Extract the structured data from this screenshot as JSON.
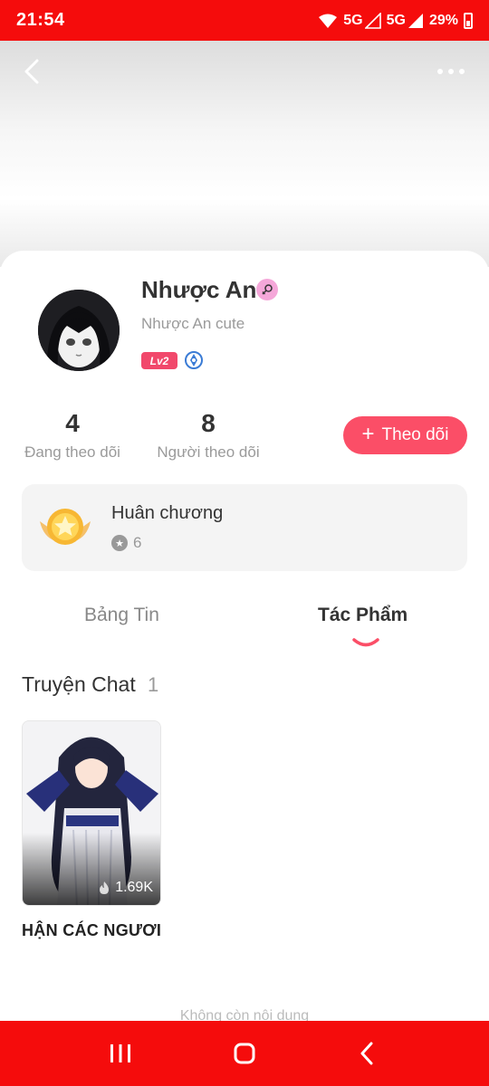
{
  "status_bar": {
    "time": "21:54",
    "network_1": "5G",
    "network_2": "5G",
    "battery": "29%"
  },
  "header": {
    "back_icon": "chevron-left-icon",
    "more_icon": "more-dots-icon"
  },
  "profile": {
    "name": "Nhược An",
    "subtitle": "Nhược An cute",
    "level": "Lv2",
    "gender_icon": "female-icon",
    "rank_icon": "rank-badge-icon"
  },
  "stats": [
    {
      "value": "4",
      "label": "Đang theo dõi"
    },
    {
      "value": "8",
      "label": "Người theo dõi"
    }
  ],
  "follow_button": {
    "label": "Theo dõi",
    "color": "#fb4e67"
  },
  "medals": {
    "title": "Huân chương",
    "count": "6"
  },
  "tabs": [
    {
      "label": "Bảng Tin",
      "active": false
    },
    {
      "label": "Tác Phẩm",
      "active": true
    }
  ],
  "section": {
    "title": "Truyện Chat",
    "count": "1"
  },
  "stories": [
    {
      "title": "HẬN CÁC NGƯƠI",
      "views": "1.69K"
    }
  ],
  "end_text": "Không còn nội dung",
  "colors": {
    "status_bar": "#f50c0c",
    "accent": "#fb4e67",
    "level_badge": "#f1486b"
  }
}
